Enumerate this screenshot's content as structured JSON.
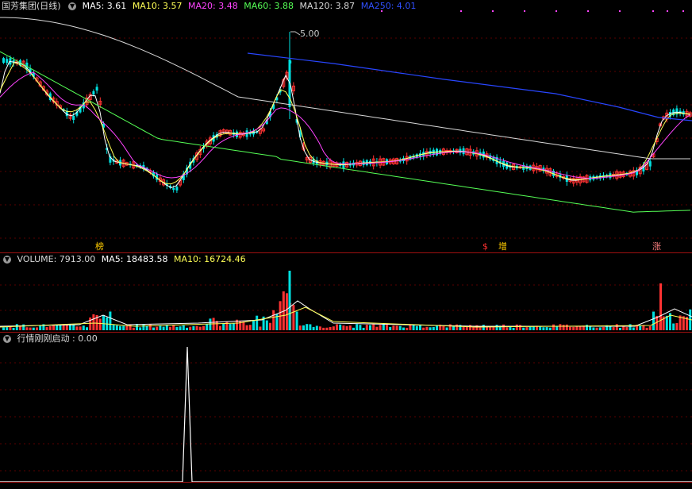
{
  "main": {
    "title": "国芳集团(日线)",
    "indicators": [
      {
        "label": "MA5: 3.61",
        "color": "#ffffff"
      },
      {
        "label": "MA10: 3.57",
        "color": "#ffff55"
      },
      {
        "label": "MA20: 3.48",
        "color": "#ff44ff"
      },
      {
        "label": "MA60: 3.88",
        "color": "#55ff55"
      },
      {
        "label": "MA120: 3.87",
        "color": "#d8d8d8"
      },
      {
        "label": "MA250: 4.01",
        "color": "#3050ff"
      }
    ],
    "peak_label": "5.00",
    "markers": [
      {
        "text": "榜",
        "color": "#ffcc00"
      },
      {
        "text": "$",
        "color": "#ff3030"
      },
      {
        "text": "增",
        "color": "#ffcc00"
      },
      {
        "text": "涨",
        "color": "#ff8080"
      }
    ]
  },
  "volume": {
    "title": "VOLUME: 7913.00",
    "ma5": "MA5: 18483.58",
    "ma10": "MA10: 16724.46"
  },
  "signal": {
    "title": "行情刚刚启动 : 0.00"
  },
  "colors": {
    "up": "#ff3232",
    "down": "#00e0e0",
    "separator": "#a01010",
    "grid": "#5a0000"
  }
}
